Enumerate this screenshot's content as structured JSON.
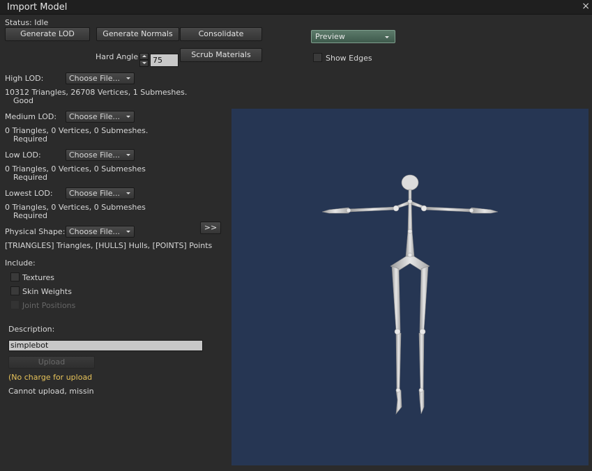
{
  "window": {
    "title": "Import Model",
    "close_glyph": "×"
  },
  "status": {
    "text": "Status: Idle"
  },
  "toolbar": {
    "generate_lod": "Generate LOD",
    "generate_normals": "Generate Normals",
    "consolidate": "Consolidate",
    "scrub_materials": "Scrub Materials",
    "hard_angle_label": "Hard Angle",
    "hard_angle_value": "75"
  },
  "preview": {
    "mode": "Preview",
    "show_edges_label": "Show Edges",
    "show_edges_checked": false
  },
  "lods": [
    {
      "label": "High LOD:",
      "choose": "Choose File...",
      "info": "10312 Triangles, 26708 Vertices, 1 Submeshes.",
      "state": "Good"
    },
    {
      "label": "Medium LOD:",
      "choose": "Choose File...",
      "info": "0 Triangles, 0 Vertices, 0 Submeshes.",
      "state": "Required"
    },
    {
      "label": "Low LOD:",
      "choose": "Choose File...",
      "info": "0 Triangles, 0 Vertices, 0 Submeshes",
      "state": "Required"
    },
    {
      "label": "Lowest LOD:",
      "choose": "Choose File...",
      "info": "0 Triangles, 0 Vertices, 0 Submeshes",
      "state": "Required"
    }
  ],
  "physics": {
    "label": "Physical Shape:",
    "choose": "Choose File...",
    "expand": ">>",
    "info": "[TRIANGLES] Triangles, [HULLS] Hulls, [POINTS] Points"
  },
  "include": {
    "label": "Include:",
    "textures": "Textures",
    "skin_weights": "Skin Weights",
    "joint_positions": "Joint Positions"
  },
  "description": {
    "label": "Description:",
    "value": "simplebot"
  },
  "upload": {
    "button": "Upload",
    "charge_note": "(No charge for upload",
    "status": "Cannot upload, missin"
  },
  "colors": {
    "viewport_bg": "#263653",
    "note": "#e7c35a",
    "preview_accent": "#5c7a6a"
  }
}
